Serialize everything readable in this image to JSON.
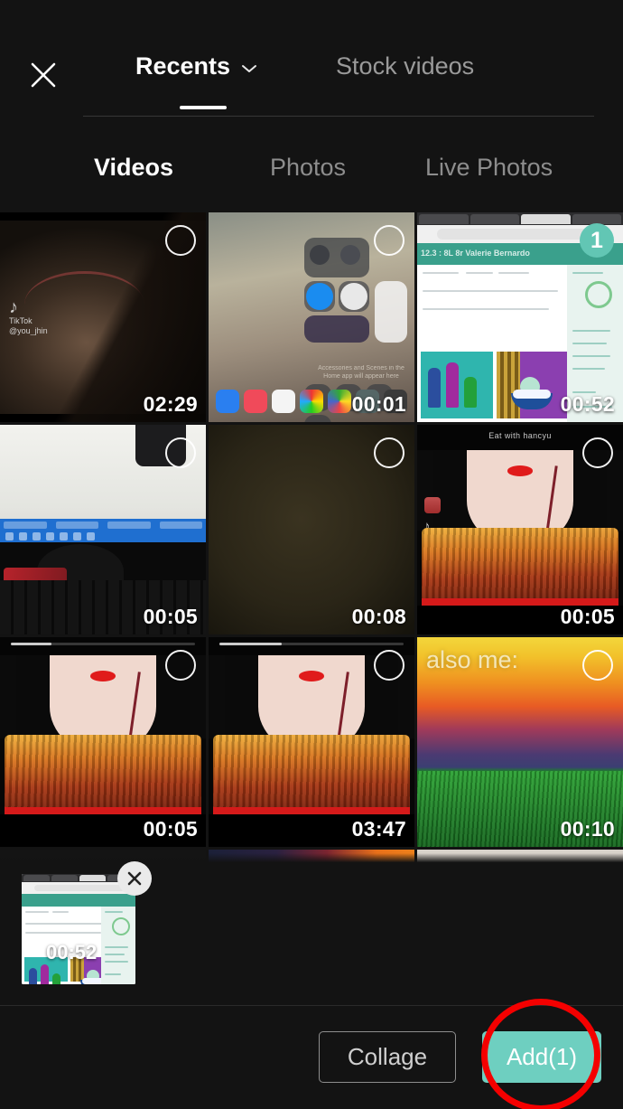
{
  "header": {
    "close_icon": "close-icon",
    "source_tabs": [
      {
        "label": "Recents",
        "active": true,
        "has_chevron": true,
        "chevron_icon": "chevron-down-icon"
      },
      {
        "label": "Stock videos",
        "active": false,
        "has_chevron": false
      }
    ]
  },
  "media_tabs": [
    {
      "label": "Videos",
      "active": true
    },
    {
      "label": "Photos",
      "active": false
    },
    {
      "label": "Live Photos",
      "active": false
    }
  ],
  "grid": {
    "items": [
      {
        "duration": "02:29",
        "selected": false,
        "art": "a-girl",
        "overlay_brand": "TikTok",
        "overlay_handle": "@you_jhin"
      },
      {
        "duration": "00:01",
        "selected": false,
        "art": "a-ios",
        "overlay_text": "Accessories and Scenes in the Home app will appear here"
      },
      {
        "duration": "00:52",
        "selected": true,
        "badge": "1",
        "art": "a-web",
        "overlay_text": "12.3 : 8L 8r Valerie Bernardo"
      },
      {
        "duration": "00:05",
        "selected": false,
        "art": "a-desk"
      },
      {
        "duration": "00:08",
        "selected": false,
        "art": "a-dark"
      },
      {
        "duration": "00:05",
        "selected": false,
        "art": "a-muk",
        "overlay_text": "Eat with hancyu"
      },
      {
        "duration": "00:05",
        "selected": false,
        "art": "a-muk"
      },
      {
        "duration": "03:47",
        "selected": false,
        "art": "a-muk"
      },
      {
        "duration": "00:10",
        "selected": false,
        "art": "a-grass",
        "overlay_text": "also me:"
      }
    ],
    "partial_row": [
      {
        "art": "a-partial-a",
        "selected": false
      },
      {
        "art": "a-partial-b",
        "selected": false
      },
      {
        "art": "a-partial-c",
        "selected": false
      }
    ]
  },
  "selection_tray": {
    "items": [
      {
        "duration": "00:52",
        "remove_icon": "close-icon"
      }
    ]
  },
  "bottom_bar": {
    "collage_label": "Collage",
    "add_label": "Add(1)"
  },
  "annotation": {
    "shape": "circle",
    "color": "#f40000",
    "target": "add-button"
  },
  "colors": {
    "background": "#131313",
    "accent_teal": "#6ecfc0",
    "badge_teal": "#62c6b4",
    "active_text": "#ffffff",
    "inactive_text": "#8d8d8d",
    "annotation_red": "#f40000"
  }
}
